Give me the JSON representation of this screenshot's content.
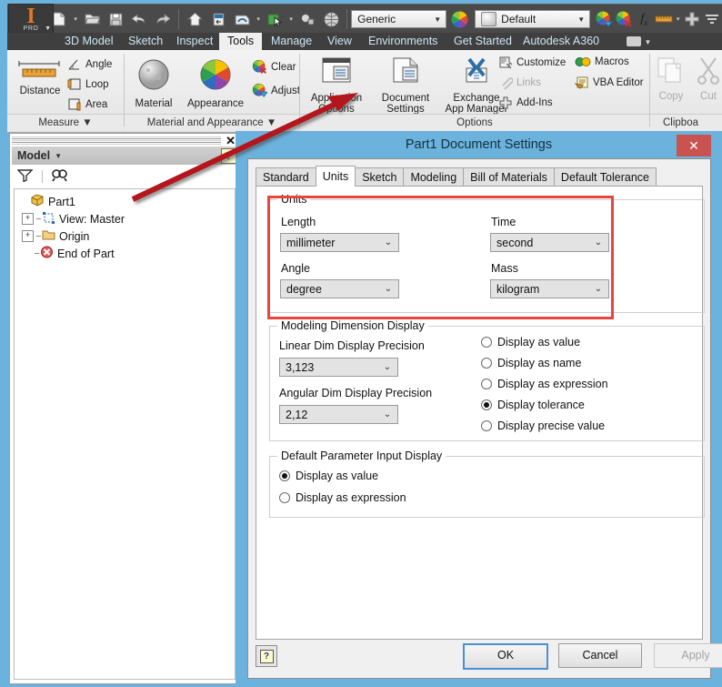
{
  "quick_access": {
    "logo": {
      "glyph": "I",
      "sub": "PRO",
      "name": "inventor-logo"
    },
    "items": [
      {
        "name": "new-file-icon",
        "label": "New"
      },
      {
        "name": "open-file-icon",
        "label": "Open"
      },
      {
        "name": "save-icon",
        "label": "Save"
      },
      {
        "name": "undo-icon",
        "label": "Undo"
      },
      {
        "name": "redo-icon",
        "label": "Redo"
      },
      {
        "name": "home-icon",
        "label": "Home"
      },
      {
        "name": "return-icon",
        "label": "Return"
      },
      {
        "name": "update-icon",
        "label": "Update"
      },
      {
        "name": "select-icon",
        "label": "Select"
      },
      {
        "name": "appearance-icon",
        "label": "Appearance"
      },
      {
        "name": "material-browser-icon",
        "label": "Material"
      }
    ],
    "material_combo": {
      "value": "Generic"
    },
    "appearance_combo": {
      "value": "Default"
    },
    "fx_label": "fx"
  },
  "ribbon_tabs": [
    {
      "label": "3D Model",
      "active": false
    },
    {
      "label": "Sketch",
      "active": false
    },
    {
      "label": "Inspect",
      "active": false
    },
    {
      "label": "Tools",
      "active": true
    },
    {
      "label": "Manage",
      "active": false
    },
    {
      "label": "View",
      "active": false
    },
    {
      "label": "Environments",
      "active": false
    },
    {
      "label": "Get Started",
      "active": false
    },
    {
      "label": "Autodesk A360",
      "active": false
    }
  ],
  "ribbon": {
    "panels": [
      {
        "title": "Measure",
        "title_caret": "▼",
        "big": [
          {
            "label": "Distance",
            "icon": "ruler-icon"
          }
        ],
        "small": [
          {
            "label": "Angle",
            "icon": "angle-icon",
            "disabled": false
          },
          {
            "label": "Loop",
            "icon": "loop-icon",
            "disabled": false
          },
          {
            "label": "Area",
            "icon": "area-icon",
            "disabled": false
          }
        ]
      },
      {
        "title": "Material and Appearance",
        "title_caret": "▼",
        "big": [
          {
            "label": "Material",
            "icon": "material-sphere-icon"
          },
          {
            "label": "Appearance",
            "icon": "appearance-wheel-icon"
          }
        ],
        "small": [
          {
            "label": "Clear",
            "icon": "clear-appearance-icon",
            "disabled": false
          },
          {
            "label": "Adjust",
            "icon": "adjust-appearance-icon",
            "disabled": false
          }
        ]
      },
      {
        "title": "Options",
        "title_caret": "",
        "big": [
          {
            "label": "Application\nOptions",
            "icon": "application-options-icon"
          },
          {
            "label": "Document\nSettings",
            "icon": "document-settings-icon"
          },
          {
            "label": "Exchange\nApp Manager",
            "icon": "exchange-app-manager-icon"
          }
        ],
        "small": [
          {
            "label": "Customize",
            "icon": "customize-icon",
            "disabled": false
          },
          {
            "label": "Links",
            "icon": "links-icon",
            "disabled": true
          },
          {
            "label": "Add-Ins",
            "icon": "add-ins-icon",
            "disabled": false
          },
          {
            "label": "Macros",
            "icon": "macros-icon",
            "disabled": false
          },
          {
            "label": "VBA Editor",
            "icon": "vba-editor-icon",
            "disabled": false
          }
        ]
      },
      {
        "title": "Clipboa",
        "title_caret": "",
        "big": [
          {
            "label": "Copy",
            "icon": "copy-icon",
            "disabled": true
          },
          {
            "label": "Cut",
            "icon": "cut-icon",
            "disabled": true
          }
        ],
        "small": []
      }
    ]
  },
  "browser": {
    "title": "Model",
    "title_caret": "▼",
    "close": "✕",
    "help": "?",
    "tools": [
      {
        "name": "filter-icon",
        "label": "Filter"
      },
      {
        "name": "find-icon",
        "label": "Find"
      }
    ],
    "tree": [
      {
        "label": "Part1",
        "icon": "part-icon",
        "expander": "",
        "indent": 0
      },
      {
        "label": "View: Master",
        "icon": "view-icon",
        "expander": "+",
        "indent": 1
      },
      {
        "label": "Origin",
        "icon": "folder-icon",
        "expander": "+",
        "indent": 1
      },
      {
        "label": "End of Part",
        "icon": "end-of-part-icon",
        "expander": "",
        "indent": 1
      }
    ]
  },
  "dialog": {
    "title": "Part1 Document Settings",
    "close_label": "✕",
    "tabs": [
      {
        "label": "Standard",
        "active": false
      },
      {
        "label": "Units",
        "active": true
      },
      {
        "label": "Sketch",
        "active": false
      },
      {
        "label": "Modeling",
        "active": false
      },
      {
        "label": "Bill of Materials",
        "active": false
      },
      {
        "label": "Default Tolerance",
        "active": false
      }
    ],
    "units_group": {
      "legend": "Units",
      "fields": [
        {
          "label": "Length",
          "value": "millimeter",
          "name": "length-units-combo"
        },
        {
          "label": "Time",
          "value": "second",
          "name": "time-units-combo"
        },
        {
          "label": "Angle",
          "value": "degree",
          "name": "angle-units-combo"
        },
        {
          "label": "Mass",
          "value": "kilogram",
          "name": "mass-units-combo"
        }
      ]
    },
    "modeling_group": {
      "legend": "Modeling Dimension Display",
      "linear_label": "Linear Dim Display Precision",
      "linear_value": "3,123",
      "angular_label": "Angular Dim Display Precision",
      "angular_value": "2,12",
      "radios": [
        {
          "label": "Display as value",
          "checked": false
        },
        {
          "label": "Display as name",
          "checked": false
        },
        {
          "label": "Display as expression",
          "checked": false
        },
        {
          "label": "Display tolerance",
          "checked": true
        },
        {
          "label": "Display precise value",
          "checked": false
        }
      ]
    },
    "param_group": {
      "legend": "Default Parameter Input Display",
      "radios": [
        {
          "label": "Display as value",
          "checked": true
        },
        {
          "label": "Display as expression",
          "checked": false
        }
      ]
    },
    "footer": {
      "help": "?",
      "ok": "OK",
      "cancel": "Cancel",
      "apply": "Apply",
      "apply_disabled": true
    }
  },
  "annotation": {
    "arrow_color": "#b3191c",
    "highlight_color": "#e8453c",
    "points_at": "Document Settings"
  },
  "colors": {
    "window_frame": "#6BB2DC",
    "ribbon_bg": "#efefef",
    "accent_orange": "#E87722",
    "close_red": "#c9534f",
    "default_button_blue": "#4a90d9"
  }
}
